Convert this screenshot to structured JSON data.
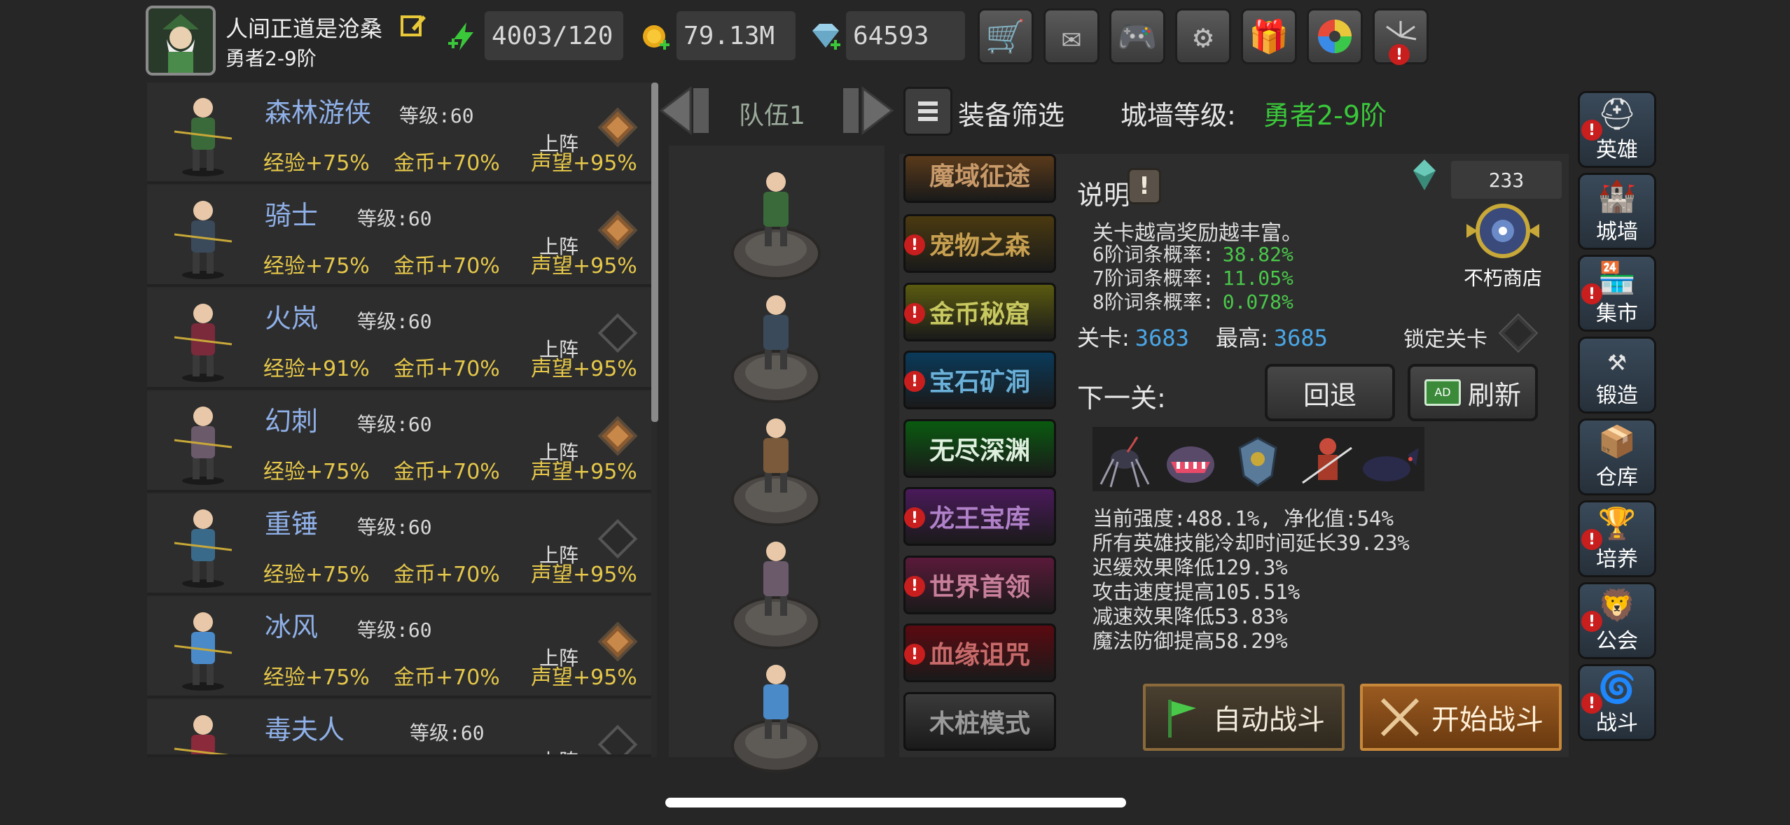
{
  "player": {
    "name": "人间正道是沧桑",
    "rank": "勇者2-9阶"
  },
  "resources": {
    "stamina": "4003/120",
    "gold": "79.13M",
    "gems": "64593"
  },
  "top_buttons": [
    "cart-icon",
    "mail-icon",
    "gamepad-icon",
    "gear-icon",
    "gift-icon",
    "color-wheel-icon",
    "firework-icon"
  ],
  "team": {
    "title": "队伍1"
  },
  "filter": {
    "label": "装备筛选",
    "wall_label": "城墙等级:",
    "wall_value": "勇者2-9阶"
  },
  "hero_list": {
    "deploy_label": "上阵",
    "items": [
      {
        "name": "森林游侠",
        "level": "等级:60",
        "exp": "经验+75%",
        "gold": "金币+70%",
        "fame": "声望+95%",
        "deployed": true,
        "color": "#3a6a3a"
      },
      {
        "name": "骑士",
        "level": "等级:60",
        "exp": "经验+75%",
        "gold": "金币+70%",
        "fame": "声望+95%",
        "deployed": true,
        "color": "#3a4a5a"
      },
      {
        "name": "火岚",
        "level": "等级:60",
        "exp": "经验+91%",
        "gold": "金币+70%",
        "fame": "声望+95%",
        "deployed": false,
        "color": "#7a2a3a"
      },
      {
        "name": "幻刺",
        "level": "等级:60",
        "exp": "经验+75%",
        "gold": "金币+70%",
        "fame": "声望+95%",
        "deployed": true,
        "color": "#6a5a6a"
      },
      {
        "name": "重锤",
        "level": "等级:60",
        "exp": "经验+75%",
        "gold": "金币+70%",
        "fame": "声望+95%",
        "deployed": false,
        "color": "#3a6a8a"
      },
      {
        "name": "冰风",
        "level": "等级:60",
        "exp": "经验+75%",
        "gold": "金币+70%",
        "fame": "声望+95%",
        "deployed": true,
        "color": "#4a8ac8"
      },
      {
        "name": "毒夫人",
        "level": "等级:60",
        "exp": "",
        "gold": "",
        "fame": "",
        "deployed": false,
        "color": "#8a2a3a"
      }
    ]
  },
  "modes": [
    {
      "label": "魔域征途",
      "bg": "#5a3a1a",
      "fg": "#c89a6a",
      "alert": false
    },
    {
      "label": "宠物之森",
      "bg": "#4a3a10",
      "fg": "#c8a050",
      "alert": true
    },
    {
      "label": "金币秘窟",
      "bg": "#5a5a10",
      "fg": "#c8c860",
      "alert": true
    },
    {
      "label": "宝石矿洞",
      "bg": "#0a3a5a",
      "fg": "#6ab0d8",
      "alert": true
    },
    {
      "label": "无尽深渊",
      "bg": "#0a5a10",
      "fg": "#dff0df",
      "alert": false
    },
    {
      "label": "龙王宝库",
      "bg": "#4a1a5a",
      "fg": "#b080c8",
      "alert": true
    },
    {
      "label": "世界首领",
      "bg": "#5a1a3a",
      "fg": "#c8809a",
      "alert": true
    },
    {
      "label": "血缘诅咒",
      "bg": "#5a0a10",
      "fg": "#c86a6a",
      "alert": true
    },
    {
      "label": "木桩模式",
      "bg": "#3a3a3a",
      "fg": "#9a9a9a",
      "alert": false
    }
  ],
  "info": {
    "title": "说明",
    "line1": "关卡越高奖励越丰富。",
    "prob6_label": "6阶词条概率:",
    "prob6": "38.82%",
    "prob7_label": "7阶词条概率:",
    "prob7": "11.05%",
    "prob8_label": "8阶词条概率:",
    "prob8": "0.078%",
    "shop_count": "233",
    "shop_label": "不朽商店",
    "stage_label": "关卡:",
    "stage": "3683",
    "best_label": "最高:",
    "best": "3685",
    "lock_label": "锁定关卡",
    "next_label": "下一关:",
    "back_label": "回退",
    "refresh_label": "刷新",
    "effects": [
      "当前强度:488.1%, 净化值:54%",
      "所有英雄技能冷却时间延长39.23%",
      "迟缓效果降低129.3%",
      "攻击速度提高105.51%",
      "减速效果降低53.83%",
      "魔法防御提高58.29%"
    ],
    "auto_battle": "自动战斗",
    "start_battle": "开始战斗"
  },
  "right_menu": [
    {
      "label": "英雄",
      "icon": "helmet-icon",
      "alert": true
    },
    {
      "label": "城墙",
      "icon": "wall-icon",
      "alert": false
    },
    {
      "label": "集市",
      "icon": "market-icon",
      "alert": true
    },
    {
      "label": "锻造",
      "icon": "anvil-icon",
      "alert": false
    },
    {
      "label": "仓库",
      "icon": "warehouse-icon",
      "alert": false
    },
    {
      "label": "培养",
      "icon": "cultivate-icon",
      "alert": true
    },
    {
      "label": "公会",
      "icon": "guild-icon",
      "alert": true
    },
    {
      "label": "战斗",
      "icon": "portal-icon",
      "alert": true
    }
  ]
}
